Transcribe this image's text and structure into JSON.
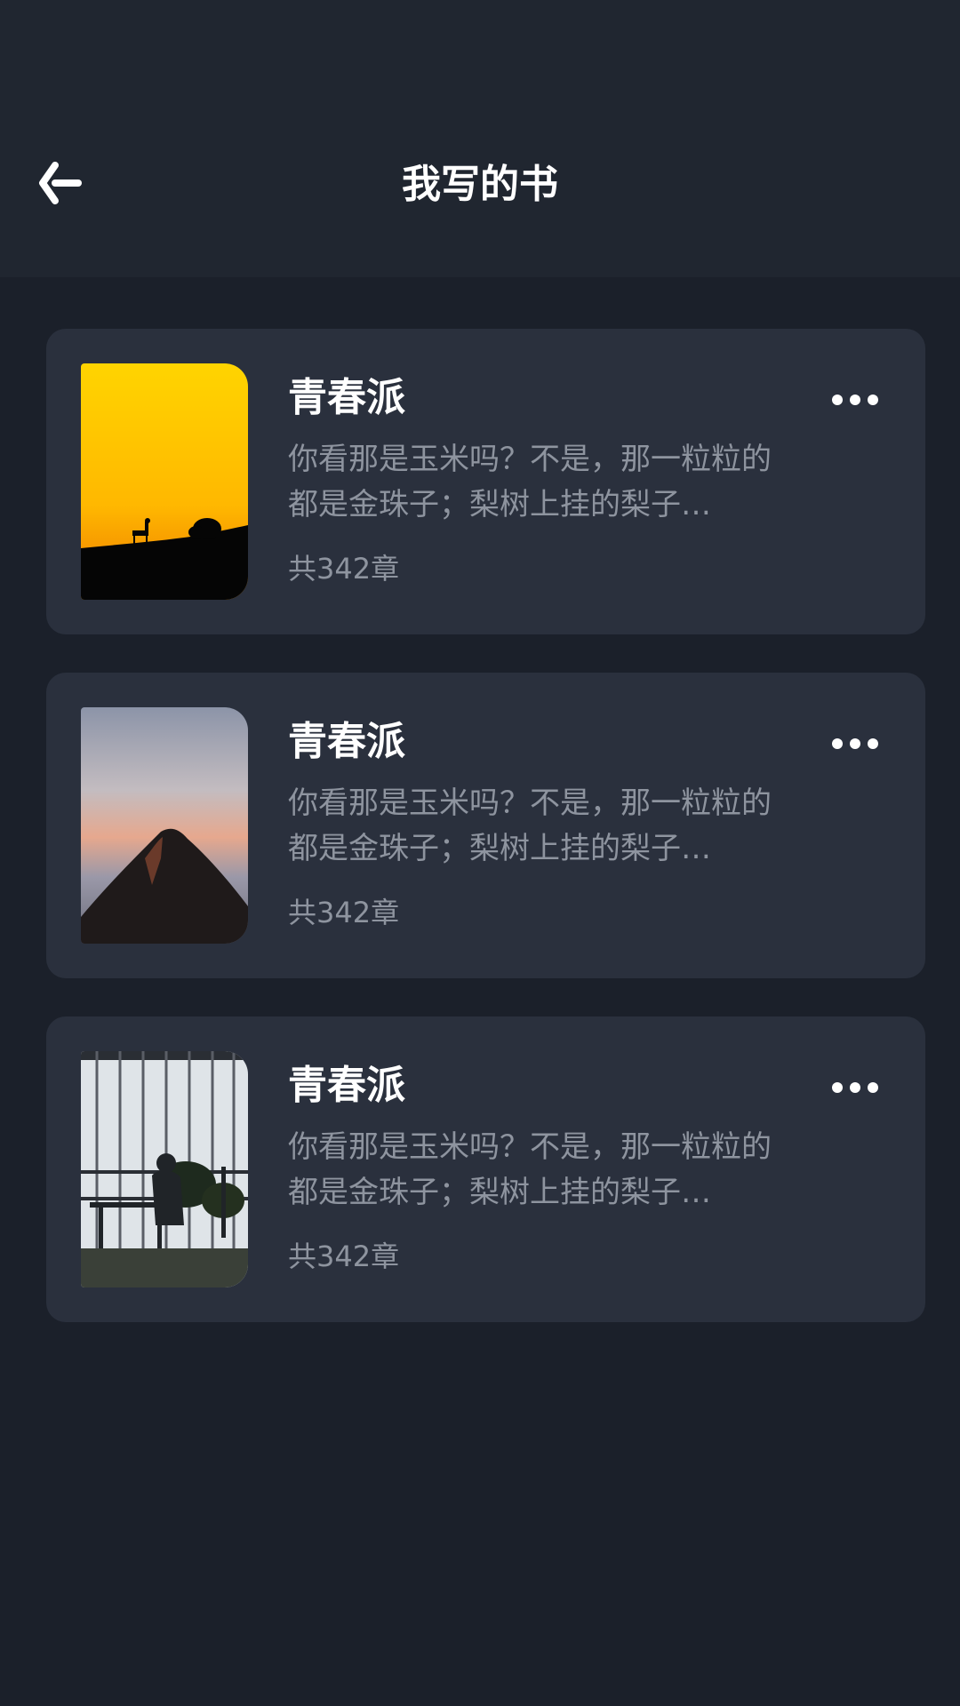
{
  "header": {
    "title": "我写的书",
    "back_icon": "back-arrow-icon"
  },
  "books": [
    {
      "title": "青春派",
      "description": "你看那是玉米吗？不是，那一粒粒的都是金珠子；梨树上挂的梨子…",
      "chapters": "共342章",
      "cover": "sunset-deer-cover",
      "more_icon": "more-icon"
    },
    {
      "title": "青春派",
      "description": "你看那是玉米吗？不是，那一粒粒的都是金珠子；梨树上挂的梨子…",
      "chapters": "共342章",
      "cover": "mountain-peak-cover",
      "more_icon": "more-icon"
    },
    {
      "title": "青春派",
      "description": "你看那是玉米吗？不是，那一粒粒的都是金珠子；梨树上挂的梨子…",
      "chapters": "共342章",
      "cover": "window-silhouette-cover",
      "more_icon": "more-icon"
    }
  ],
  "colors": {
    "background": "#1b202a",
    "header": "#202630",
    "card": "#2a303d",
    "title_text": "#ffffff",
    "secondary_text": "#8e949f"
  }
}
